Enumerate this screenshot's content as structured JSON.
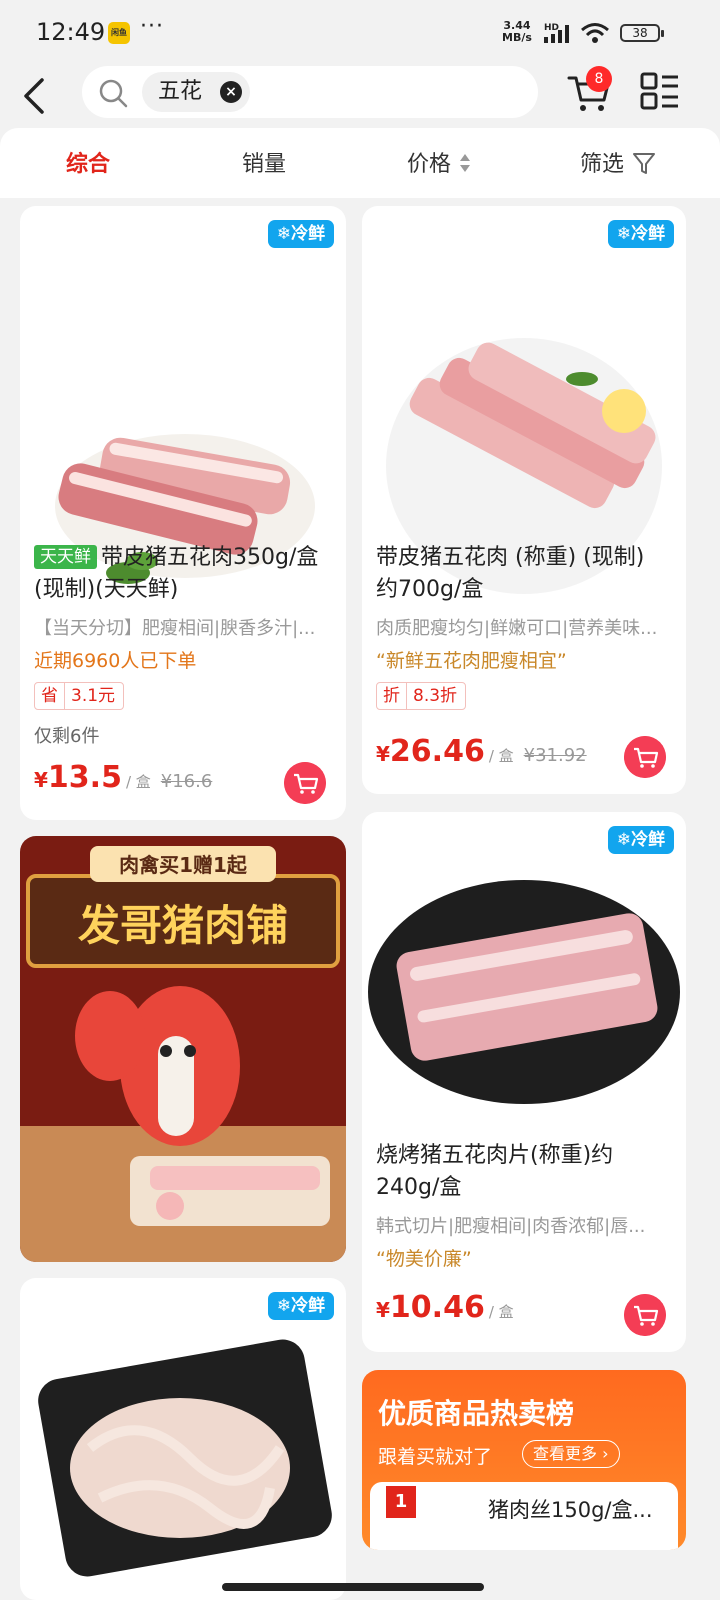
{
  "status_bar": {
    "time": "12:49",
    "app_icon_text": "闲鱼",
    "more": "···",
    "net_speed_value": "3.44",
    "net_speed_unit": "MB/s",
    "signal_label": "HD",
    "battery": "38"
  },
  "search": {
    "chip": "五花",
    "clear_icon": "×"
  },
  "cart": {
    "badge": "8"
  },
  "sort_tabs": [
    {
      "label": "综合"
    },
    {
      "label": "销量"
    },
    {
      "label": "价格"
    },
    {
      "label": "筛选"
    }
  ],
  "cold_badge": "❄冷鲜",
  "products": [
    {
      "tag": "天天鲜",
      "title": "带皮猪五花肉350g/盒(现制)(天天鲜)",
      "desc": "【当天分切】肥瘦相间|腴香多汁|...",
      "sales": "近期6960人已下单",
      "promo_label": "省",
      "promo_value": "3.1元",
      "stock": "仅剩6件",
      "currency": "¥",
      "price": "13.5",
      "unit": "/ 盒",
      "orig": "¥16.6"
    },
    {
      "title": "带皮猪五花肉 (称重) (现制) 约700g/盒",
      "desc": "肉质肥瘦均匀|鲜嫩可口|营养美味...",
      "slogan": "“新鲜五花肉肥瘦相宜”",
      "promo_label": "折",
      "promo_value": "8.3折",
      "currency": "¥",
      "price": "26.46",
      "unit": "/ 盒",
      "orig": "¥31.92"
    },
    {
      "title": "烧烤猪五花肉片(称重)约240g/盒",
      "desc": "韩式切片|肥瘦相间|肉香浓郁|唇...",
      "slogan": "“物美价廉”",
      "currency": "¥",
      "price": "10.46",
      "unit": "/ 盒"
    }
  ],
  "banner": {
    "top_text": "肉禽买1赠1起",
    "shop_name": "发哥猪肉铺"
  },
  "ranking": {
    "title": "优质商品热卖榜",
    "subtitle": "跟着买就对了",
    "more": "查看更多 ›",
    "first_no": "1",
    "first_item": "猪肉丝150g/盒..."
  },
  "colors": {
    "accent_red": "#e1251b",
    "cold_blue": "#12a5ee",
    "sales_orange": "#e3761a",
    "cart_pink": "#f43d55",
    "rank_orange": "#ff6a1f"
  }
}
